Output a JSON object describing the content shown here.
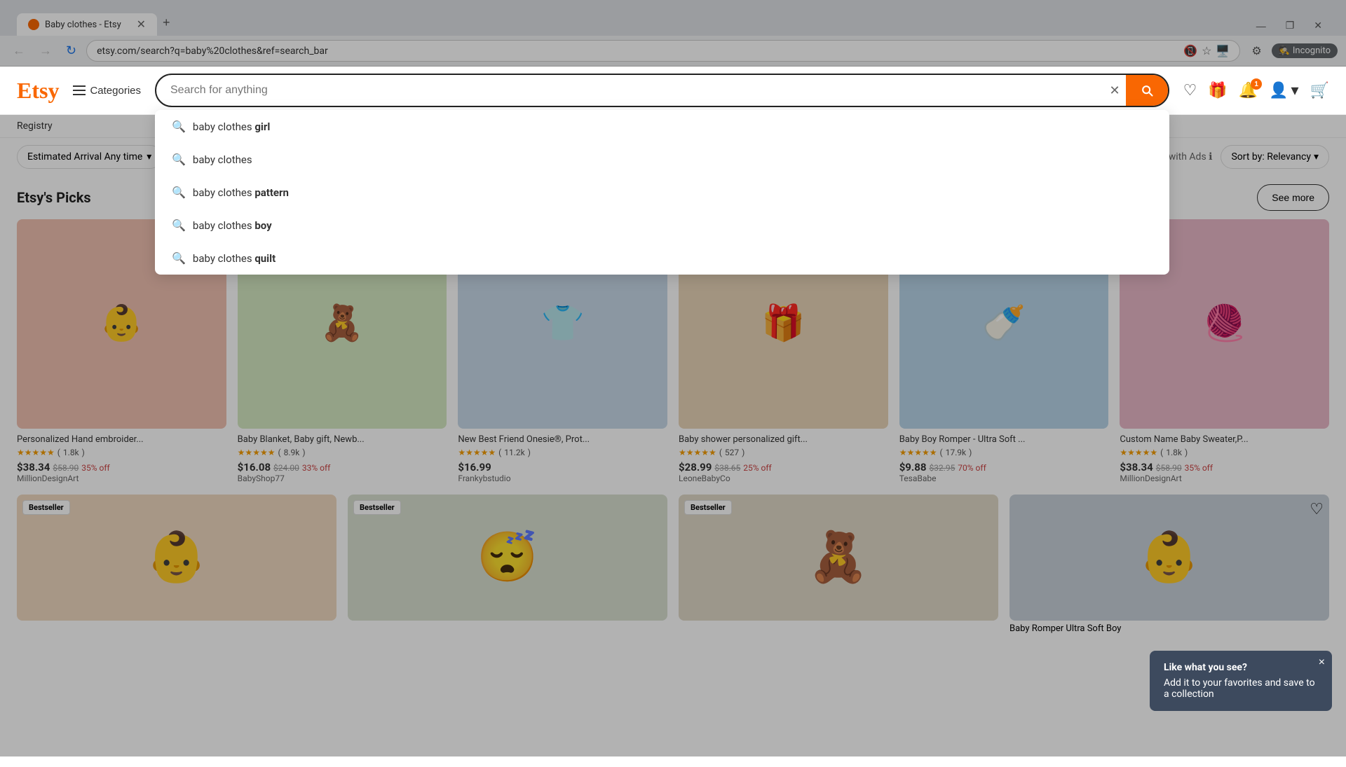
{
  "browser": {
    "tab_title": "Baby clothes - Etsy",
    "url": "etsy.com/search?q=baby%20clothes&ref=search_bar",
    "new_tab_label": "+",
    "back_title": "Back",
    "forward_title": "Forward",
    "reload_title": "Reload",
    "incognito_label": "Incognito"
  },
  "header": {
    "logo": "Etsy",
    "categories_label": "Categories",
    "search_placeholder": "Search for anything",
    "search_value": "",
    "nav_items": [
      "Registry"
    ]
  },
  "autocomplete": {
    "items": [
      {
        "prefix": "baby clothes ",
        "bold": "girl"
      },
      {
        "prefix": "baby clothes",
        "bold": ""
      },
      {
        "prefix": "baby clothes ",
        "bold": "pattern"
      },
      {
        "prefix": "baby clothes ",
        "bold": "boy"
      },
      {
        "prefix": "baby clothes ",
        "bold": "quilt"
      }
    ]
  },
  "filters": {
    "estimated_arrival_label": "Estimated Arrival",
    "estimated_arrival_value": "Any time",
    "more_filters_label": "...",
    "results_info": "+ results, with Ads",
    "sort_label": "Sort by: Relevancy"
  },
  "picks_section": {
    "title": "Etsy's Picks",
    "see_more_label": "See more"
  },
  "products": [
    {
      "title": "Personalized Hand embroider...",
      "rating": "4.5",
      "review_count": "1.8k",
      "price": "$38.34",
      "original_price": "$58.90",
      "discount": "35% off",
      "shop": "MillionDesignArt",
      "bg_color": "#f0c0b0",
      "emoji": "👶"
    },
    {
      "title": "Baby Blanket, Baby gift, Newb...",
      "rating": "4.5",
      "review_count": "8.9k",
      "price": "$16.08",
      "original_price": "$24.00",
      "discount": "33% off",
      "shop": "BabyShop77",
      "bg_color": "#d4e8c2",
      "emoji": "🧸"
    },
    {
      "title": "New Best Friend Onesie®, Prot...",
      "rating": "4.5",
      "review_count": "11.2k",
      "price": "$16.99",
      "original_price": "",
      "discount": "",
      "shop": "Frankybstudio",
      "bg_color": "#c8d8e8",
      "emoji": "👕"
    },
    {
      "title": "Baby shower personalized gift...",
      "rating": "4.5",
      "review_count": "527",
      "price": "$28.99",
      "original_price": "$38.65",
      "discount": "25% off",
      "shop": "LeoneBabyCo",
      "bg_color": "#e8d4b8",
      "emoji": "🎁"
    },
    {
      "title": "Baby Boy Romper - Ultra Soft ...",
      "rating": "4.5",
      "review_count": "17.9k",
      "price": "$9.88",
      "original_price": "$32.95",
      "discount": "70% off",
      "shop": "TesaBabe",
      "bg_color": "#b8d4e8",
      "emoji": "🍼"
    },
    {
      "title": "Custom Name Baby Sweater,P...",
      "rating": "4.5",
      "review_count": "1.8k",
      "price": "$38.34",
      "original_price": "$58.90",
      "discount": "35% off",
      "shop": "MillionDesignArt",
      "bg_color": "#e8b8c8",
      "emoji": "🧶"
    }
  ],
  "bottom_products": [
    {
      "badge": "Bestseller",
      "bg_color": "#f0d8c0",
      "emoji": "👶"
    },
    {
      "badge": "Bestseller",
      "bg_color": "#d8e0d0",
      "emoji": "😴"
    },
    {
      "badge": "Bestseller",
      "bg_color": "#e0d8c8",
      "emoji": "🧸"
    },
    {
      "bg_color": "#c8d0d8",
      "emoji": "👶",
      "title": "Baby Romper Ultra Soft Boy"
    }
  ],
  "tooltip": {
    "title": "Like what you see?",
    "body": "Add it to your favorites and save to a collection",
    "close_label": "×"
  },
  "icons": {
    "search": "🔍",
    "heart": "♡",
    "gift": "🎁",
    "bell": "🔔",
    "user": "👤",
    "cart": "🛒",
    "back": "←",
    "forward": "→",
    "reload": "↻",
    "star_full": "★",
    "chevron_down": "▾",
    "clear": "✕",
    "minimize": "—",
    "maximize": "❐",
    "close_win": "✕",
    "close_tab": "✕"
  }
}
